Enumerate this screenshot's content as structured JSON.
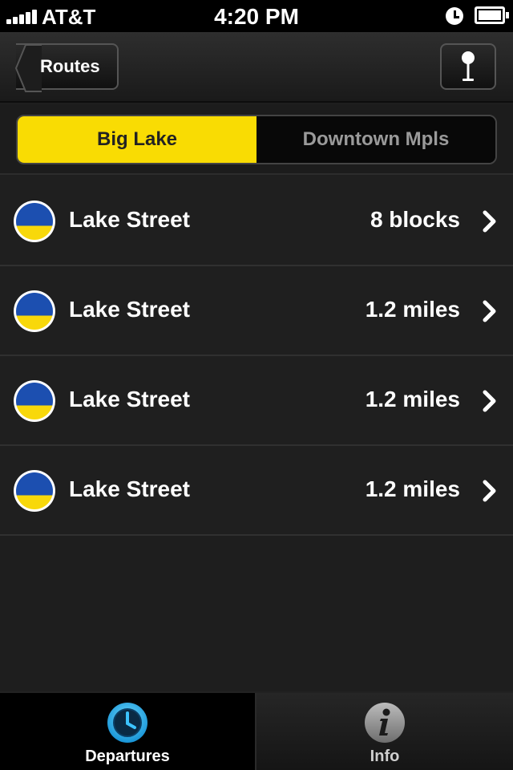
{
  "status_bar": {
    "carrier": "AT&T",
    "time": "4:20 PM"
  },
  "nav": {
    "back_label": "Routes"
  },
  "segments": [
    {
      "label": "Big Lake",
      "selected": true
    },
    {
      "label": "Downtown Mpls",
      "selected": false
    }
  ],
  "colors": {
    "accent_yellow": "#f9dc03",
    "route_blue": "#1c4fb0",
    "tab_selected_blue": "#28b8f0"
  },
  "routes": [
    {
      "name": "Lake Street",
      "distance": "8 blocks"
    },
    {
      "name": "Lake Street",
      "distance": "1.2 miles"
    },
    {
      "name": "Lake Street",
      "distance": "1.2 miles"
    },
    {
      "name": "Lake Street",
      "distance": "1.2 miles"
    }
  ],
  "tabs": [
    {
      "label": "Departures",
      "icon": "clock-icon",
      "selected": true
    },
    {
      "label": "Info",
      "icon": "info-icon",
      "selected": false
    }
  ]
}
